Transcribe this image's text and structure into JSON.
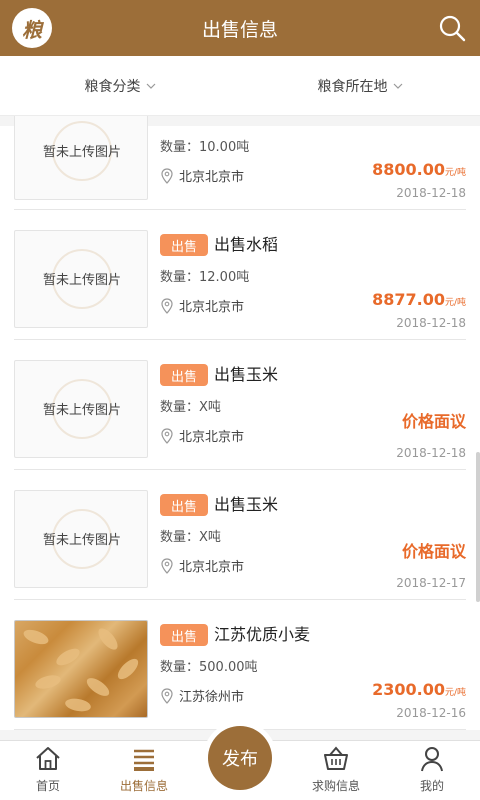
{
  "header": {
    "title": "出售信息",
    "logo_text": "粮"
  },
  "filters": {
    "category": "粮食分类",
    "location": "粮食所在地"
  },
  "listings": [
    {
      "image": "暂未上传图片",
      "tag": "",
      "title": "",
      "quantity": "数量：10.00吨",
      "location": "北京北京市",
      "price": "8800.00",
      "unit": "元/吨",
      "date": "2018-12-18"
    },
    {
      "image": "暂未上传图片",
      "tag": "出售",
      "title": "出售水稻",
      "quantity": "数量：12.00吨",
      "location": "北京北京市",
      "price": "8877.00",
      "unit": "元/吨",
      "date": "2018-12-18"
    },
    {
      "image": "暂未上传图片",
      "tag": "出售",
      "title": "出售玉米",
      "quantity": "数量：X吨",
      "location": "北京北京市",
      "price": "价格面议",
      "unit": "",
      "date": "2018-12-18"
    },
    {
      "image": "暂未上传图片",
      "tag": "出售",
      "title": "出售玉米",
      "quantity": "数量：X吨",
      "location": "北京北京市",
      "price": "价格面议",
      "unit": "",
      "date": "2018-12-17"
    },
    {
      "image": "",
      "tag": "出售",
      "title": "江苏优质小麦",
      "quantity": "数量：500.00吨",
      "location": "江苏徐州市",
      "price": "2300.00",
      "unit": "元/吨",
      "date": "2018-12-16"
    }
  ],
  "tabbar": {
    "home": "首页",
    "sell": "出售信息",
    "publish": "发布",
    "buy": "求购信息",
    "mine": "我的"
  },
  "colors": {
    "brand": "#9c6e39",
    "tag": "#f5925a",
    "price": "#e86a2a"
  }
}
